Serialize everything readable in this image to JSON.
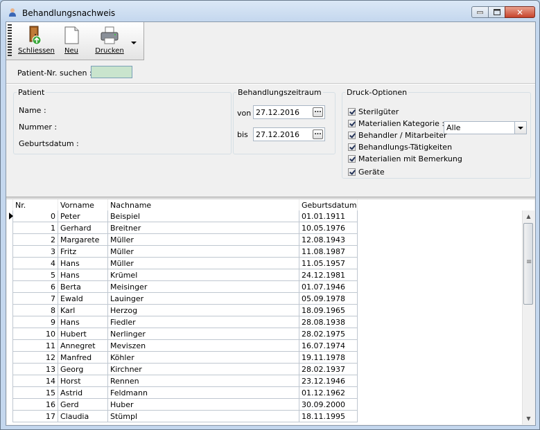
{
  "window": {
    "title": "Behandlungsnachweis"
  },
  "toolbar": {
    "close_label": "Schliessen",
    "new_label": "Neu",
    "print_label": "Drucken"
  },
  "search": {
    "label": "Patient-Nr. suchen :",
    "value": ""
  },
  "patient": {
    "group_title": "Patient",
    "name_label": "Name :",
    "number_label": "Nummer :",
    "birth_label": "Geburtsdatum :"
  },
  "period": {
    "group_title": "Behandlungszeitraum",
    "from_label": "von",
    "from_value": "27.12.2016",
    "to_label": "bis",
    "to_value": "27.12.2016"
  },
  "print_options": {
    "group_title": "Druck-Optionen",
    "category_label": "Kategorie :",
    "category_value": "Alle",
    "items": [
      {
        "label": "Sterilgüter",
        "checked": true
      },
      {
        "label": "Materialien",
        "checked": true
      },
      {
        "label": "Behandler / Mitarbeiter",
        "checked": true
      },
      {
        "label": "Behandlungs-Tätigkeiten",
        "checked": true
      },
      {
        "label": "Materialien mit Bemerkung",
        "checked": true
      },
      {
        "label": "Geräte",
        "checked": true
      }
    ]
  },
  "grid": {
    "columns": [
      "Nr.",
      "Vorname",
      "Nachname",
      "Geburtsdatum"
    ],
    "rows": [
      [
        "0",
        "Peter",
        "Beispiel",
        "01.01.1911"
      ],
      [
        "1",
        "Gerhard",
        "Breitner",
        "10.05.1976"
      ],
      [
        "2",
        "Margarete",
        "Müller",
        "12.08.1943"
      ],
      [
        "3",
        "Fritz",
        "Müller",
        "11.08.1987"
      ],
      [
        "4",
        "Hans",
        "Müller",
        "11.05.1957"
      ],
      [
        "5",
        "Hans",
        "Krümel",
        "24.12.1981"
      ],
      [
        "6",
        "Berta",
        "Meisinger",
        "01.07.1946"
      ],
      [
        "7",
        "Ewald",
        "Lauinger",
        "05.09.1978"
      ],
      [
        "8",
        "Karl",
        "Herzog",
        "18.09.1965"
      ],
      [
        "9",
        "Hans",
        "Fiedler",
        "28.08.1938"
      ],
      [
        "10",
        "Hubert",
        "Nerlinger",
        "28.02.1975"
      ],
      [
        "11",
        "Annegret",
        "Meviszen",
        "16.07.1974"
      ],
      [
        "12",
        "Manfred",
        "Köhler",
        "19.11.1978"
      ],
      [
        "13",
        "Georg",
        "Kirchner",
        "28.02.1937"
      ],
      [
        "14",
        "Horst",
        "Rennen",
        "23.12.1946"
      ],
      [
        "15",
        "Astrid",
        "Feldmann",
        "01.12.1962"
      ],
      [
        "16",
        "Gerd",
        "Huber",
        "30.09.2000"
      ],
      [
        "17",
        "Claudia",
        "Stümpl",
        "18.11.1995"
      ]
    ]
  }
}
